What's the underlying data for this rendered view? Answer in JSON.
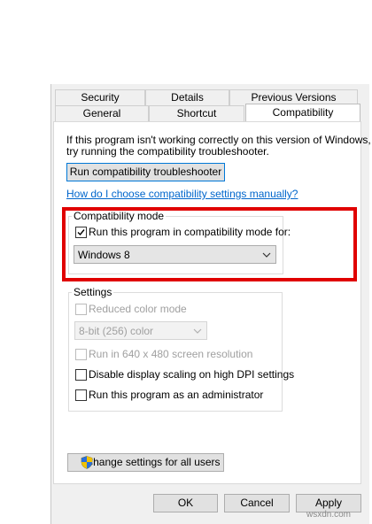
{
  "tabs": {
    "row1": [
      "Security",
      "Details",
      "Previous Versions"
    ],
    "row2": [
      "General",
      "Shortcut",
      "Compatibility"
    ],
    "active": "Compatibility"
  },
  "intro": {
    "line1": "If this program isn't working correctly on this version of Windows,",
    "line2": "try running the compatibility troubleshooter."
  },
  "troubleshooter_button": "Run compatibility troubleshooter",
  "help_link": "How do I choose compatibility settings manually?",
  "compat_mode": {
    "legend": "Compatibility mode",
    "checkbox_label": "Run this program in compatibility mode for:",
    "checked": true,
    "selected_os": "Windows 8"
  },
  "settings": {
    "legend": "Settings",
    "reduced_color": "Reduced color mode",
    "color_select": "8-bit (256) color",
    "run_640": "Run in 640 x 480 screen resolution",
    "disable_dpi": "Disable display scaling on high DPI settings",
    "run_admin": "Run this program as an administrator"
  },
  "change_settings_button": "Change settings for all users",
  "footer": {
    "ok": "OK",
    "cancel": "Cancel",
    "apply": "Apply"
  },
  "watermark": "wsxdn.com",
  "colors": {
    "highlight": "#e00000",
    "link": "#0066cc",
    "focus_border": "#0078d7"
  }
}
